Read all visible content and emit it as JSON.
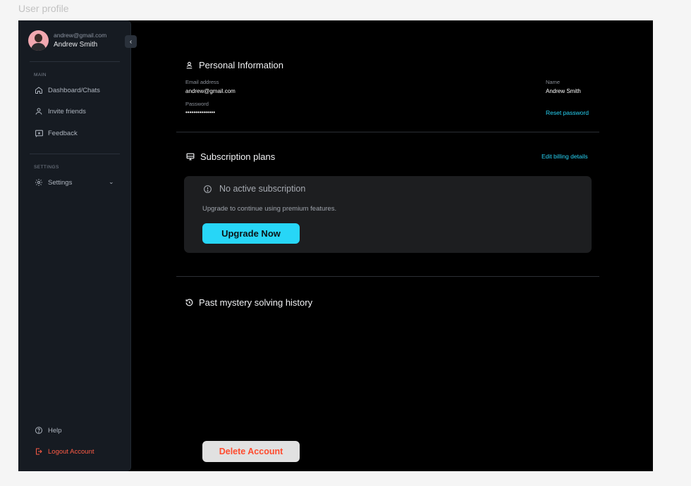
{
  "page": {
    "caption": "User profile"
  },
  "sidebar": {
    "user": {
      "email": "andrew@gmail.com",
      "name": "Andrew Smith"
    },
    "collapse_glyph": "‹",
    "main_label": "MAIN",
    "main_items": [
      {
        "label": "Dashboard/Chats",
        "icon": "home-icon"
      },
      {
        "label": "Invite friends",
        "icon": "user-icon"
      },
      {
        "label": "Feedback",
        "icon": "feedback-star-icon"
      }
    ],
    "settings_label": "SETTINGS",
    "settings_item": {
      "label": "Settings",
      "icon": "gear-icon",
      "chevron": "⌄"
    },
    "help_item": {
      "label": "Help",
      "icon": "help-circle-icon"
    },
    "logout_item": {
      "label": "Logout Account",
      "icon": "logout-icon"
    }
  },
  "personal": {
    "title": "Personal Information",
    "email_label": "Email address",
    "email_value": "andrew@gmail.com",
    "password_label": "Password",
    "password_value": "•••••••••••••••",
    "name_label": "Name",
    "name_value": "Andrew Smith",
    "reset_link": "Reset password"
  },
  "subscription": {
    "title": "Subscription plans",
    "edit_link": "Edit billing details",
    "status": "No active subscription",
    "message": "Upgrade to continue using premium features.",
    "upgrade_label": "Upgrade Now"
  },
  "history": {
    "title": "Past mystery solving history"
  },
  "delete_label": "Delete Account",
  "colors": {
    "accent": "#27d6f7",
    "danger": "#ff4b2e",
    "sidebar_bg": "#161b22",
    "card_bg": "#1d1e20"
  }
}
